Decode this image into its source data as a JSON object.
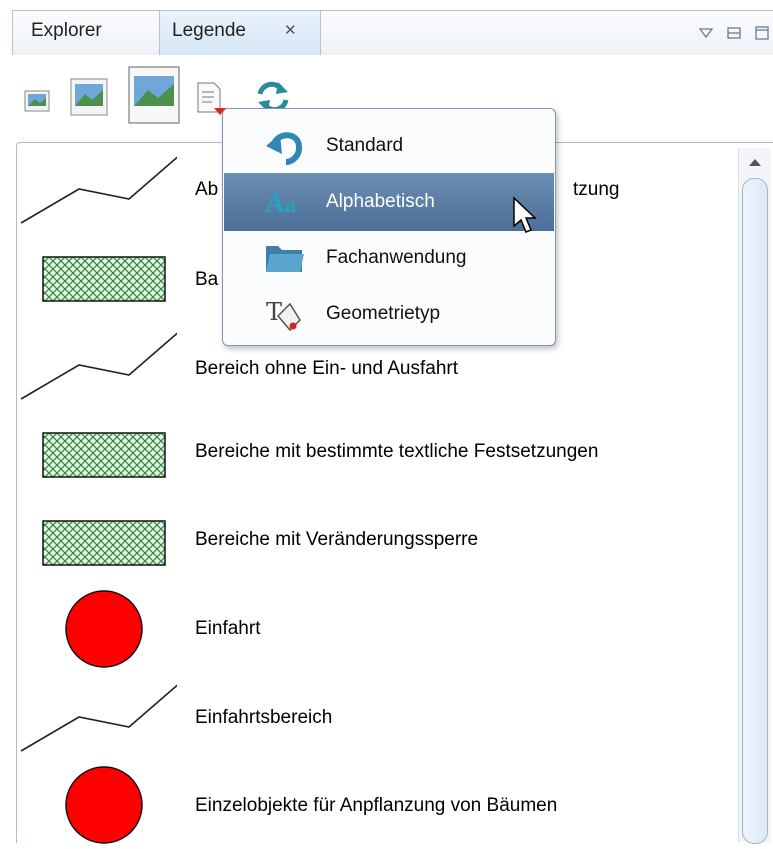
{
  "tabs": {
    "explorer_label": "Explorer",
    "legende_label": "Legende",
    "close_glyph": "✕"
  },
  "toolbar": {
    "icons": [
      "small-image-icon",
      "medium-image-icon",
      "large-image-icon",
      "sort-document-icon",
      "refresh-icon"
    ]
  },
  "sort_menu": {
    "items": [
      {
        "label": "Standard",
        "icon": "undo-arrow-icon",
        "selected": false
      },
      {
        "label": "Alphabetisch",
        "icon": "alphabet-aa-icon",
        "selected": true
      },
      {
        "label": "Fachanwendung",
        "icon": "folder-icon",
        "selected": false
      },
      {
        "label": "Geometrietyp",
        "icon": "geometry-type-icon",
        "selected": false
      }
    ]
  },
  "legend": {
    "items": [
      {
        "label": "Ab",
        "label_tail": "tzung",
        "symbol": "line"
      },
      {
        "label": "Ba",
        "symbol": "hatched-rect"
      },
      {
        "label": "Bereich ohne Ein- und Ausfahrt",
        "symbol": "line"
      },
      {
        "label": "Bereiche mit bestimmte textliche Festsetzungen",
        "symbol": "hatched-rect"
      },
      {
        "label": "Bereiche mit Veränderungssperre",
        "symbol": "hatched-rect"
      },
      {
        "label": "Einfahrt",
        "symbol": "red-circle"
      },
      {
        "label": "Einfahrtsbereich",
        "symbol": "line"
      },
      {
        "label": "Einzelobjekte für Anpflanzung von Bäumen",
        "symbol": "red-circle"
      }
    ]
  },
  "colors": {
    "menu_selected": "#5a7ca5",
    "hatch_green": "#2e8b3a",
    "circle_red": "#ff0000",
    "tab_active": "#d5e6f5"
  }
}
